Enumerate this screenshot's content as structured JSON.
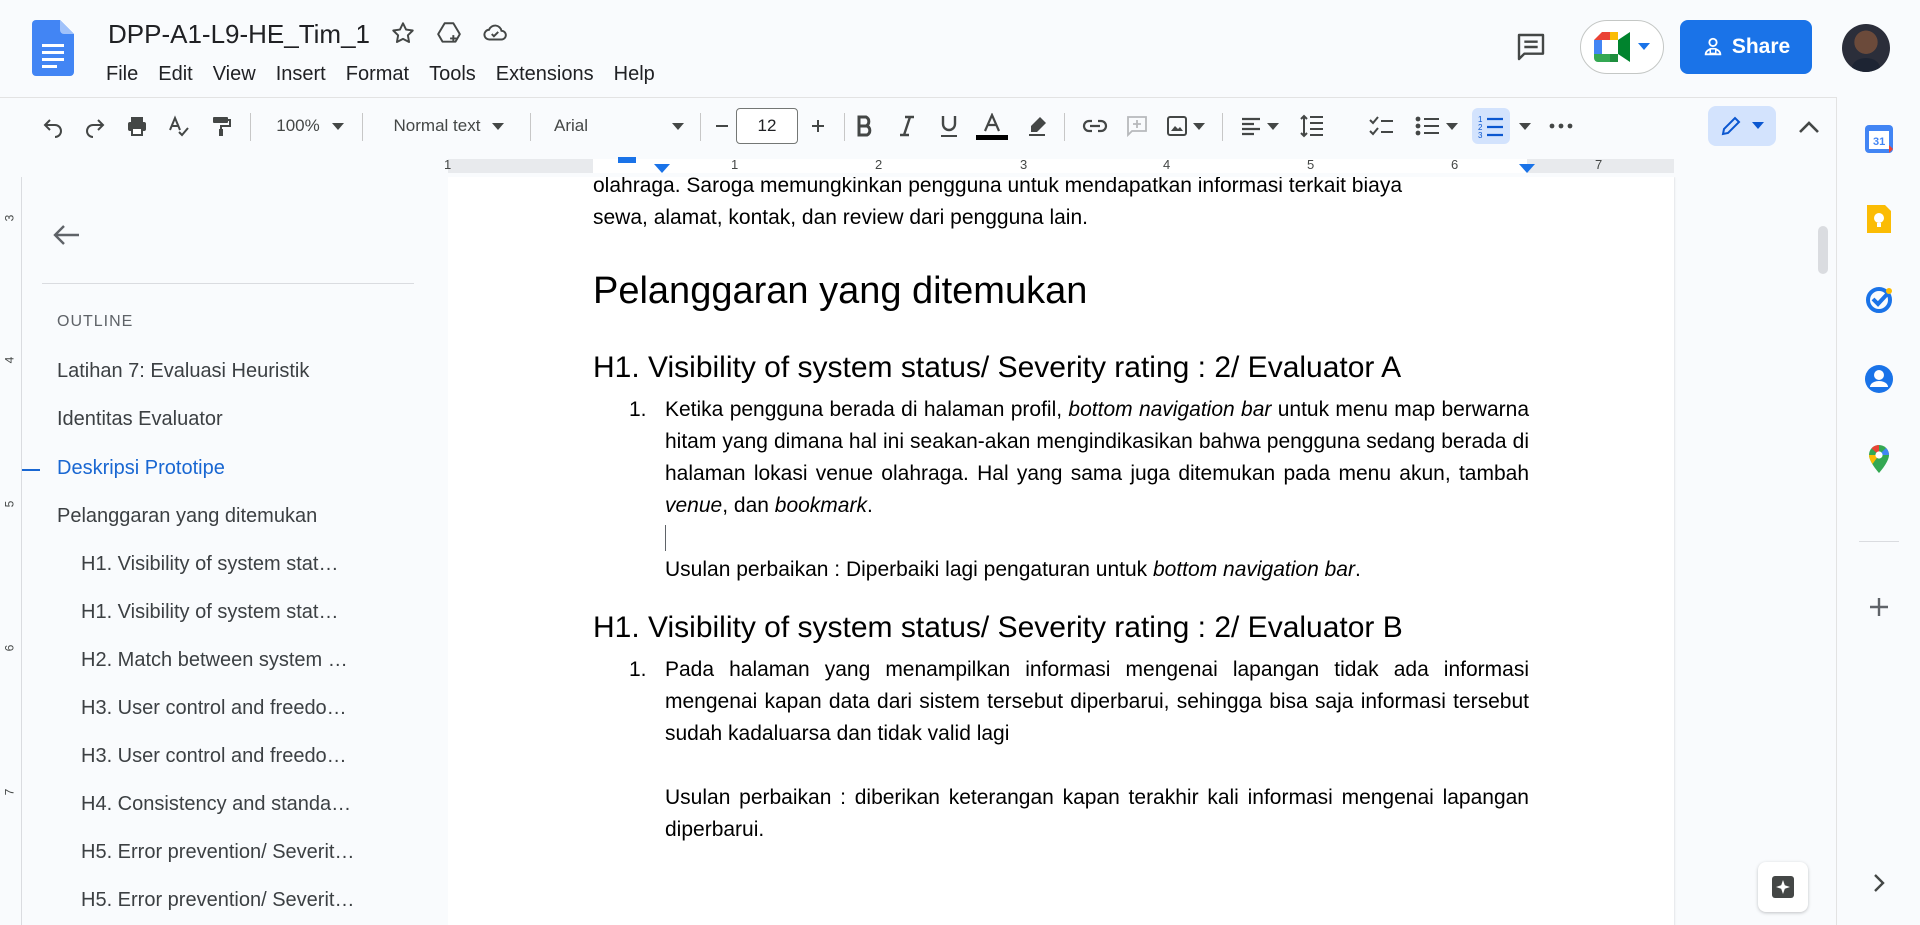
{
  "header": {
    "doc_title": "DPP-A1-L9-HE_Tim_1",
    "menu": [
      "File",
      "Edit",
      "View",
      "Insert",
      "Format",
      "Tools",
      "Extensions",
      "Help"
    ],
    "share_label": "Share"
  },
  "toolbar": {
    "zoom": "100%",
    "style": "Normal text",
    "font": "Arial",
    "font_size": "12"
  },
  "ruler": {
    "numbers": [
      "1",
      "1",
      "2",
      "3",
      "4",
      "5",
      "6",
      "7"
    ]
  },
  "vruler": {
    "numbers": [
      "3",
      "4",
      "5",
      "6",
      "7"
    ]
  },
  "outline": {
    "label": "OUTLINE",
    "items": [
      {
        "text": "Latihan 7: Evaluasi Heuristik",
        "level": 1,
        "active": false
      },
      {
        "text": "Identitas Evaluator",
        "level": 1,
        "active": false
      },
      {
        "text": "Deskripsi Prototipe",
        "level": 1,
        "active": true
      },
      {
        "text": "Pelanggaran yang ditemukan",
        "level": 1,
        "active": false
      },
      {
        "text": "H1. Visibility of system stat…",
        "level": 2,
        "active": false
      },
      {
        "text": "H1. Visibility of system stat…",
        "level": 2,
        "active": false
      },
      {
        "text": "H2. Match between system …",
        "level": 2,
        "active": false
      },
      {
        "text": "H3. User control and freedo…",
        "level": 2,
        "active": false
      },
      {
        "text": "H3. User control and freedo…",
        "level": 2,
        "active": false
      },
      {
        "text": "H4. Consistency and standa…",
        "level": 2,
        "active": false
      },
      {
        "text": "H5. Error prevention/ Severit…",
        "level": 2,
        "active": false
      },
      {
        "text": "H5. Error prevention/ Severit…",
        "level": 2,
        "active": false
      }
    ]
  },
  "document": {
    "intro_line1": "olahraga. Saroga memungkinkan pengguna untuk mendapatkan informasi terkait biaya",
    "intro_line2": "sewa, alamat, kontak, dan review dari pengguna lain.",
    "heading1": "Pelanggaran yang ditemukan",
    "sections": [
      {
        "heading": "H1. Visibility of system status/ Severity rating : 2/ Evaluator A",
        "item_number": "1.",
        "item_p1": "Ketika pengguna berada di halaman profil, ",
        "item_p1_italic": "bottom navigation bar",
        "item_p2": " untuk menu map berwarna hitam yang dimana hal ini seakan-akan mengindikasikan bahwa pengguna sedang berada di halaman lokasi venue olahraga. Hal yang sama juga ditemukan pada menu akun, tambah ",
        "item_p2_italic": "venue",
        "item_p3": ", dan ",
        "item_p3_italic": "bookmark",
        "item_p4": ".",
        "fix_prefix": "Usulan perbaikan : Diperbaiki lagi pengaturan untuk ",
        "fix_italic": "bottom navigation bar",
        "fix_suffix": "."
      },
      {
        "heading": "H1. Visibility of system status/ Severity rating : 2/ Evaluator B",
        "item_number": "1.",
        "item_text": "Pada halaman yang menampilkan informasi mengenai lapangan tidak ada informasi mengenai kapan data dari sistem tersebut diperbarui, sehingga bisa saja informasi tersebut sudah kadaluarsa dan tidak valid lagi",
        "fix_text": "Usulan perbaikan : diberikan keterangan kapan terakhir kali informasi mengenai lapangan diperbarui."
      }
    ]
  },
  "colors": {
    "accent": "#1a73e8",
    "active_outline": "#1967d2",
    "toolbar_active": "#d3e3fd"
  },
  "icons": [
    "docs-logo",
    "star-icon",
    "move-to-drive-icon",
    "cloud-saved-icon",
    "comment-icon",
    "meet-icon",
    "share-person-icon",
    "undo-icon",
    "redo-icon",
    "print-icon",
    "spellcheck-icon",
    "paint-format-icon",
    "bold-icon",
    "italic-icon",
    "underline-icon",
    "text-color-icon",
    "highlight-icon",
    "link-icon",
    "add-comment-icon",
    "image-icon",
    "align-icon",
    "line-spacing-icon",
    "checklist-icon",
    "bulleted-list-icon",
    "numbered-list-icon",
    "more-icon",
    "edit-mode-icon",
    "chevron-up-icon",
    "back-arrow-icon",
    "calendar-icon",
    "keep-icon",
    "tasks-icon",
    "contacts-icon",
    "maps-icon",
    "plus-icon",
    "chevron-right-icon",
    "explore-icon"
  ]
}
